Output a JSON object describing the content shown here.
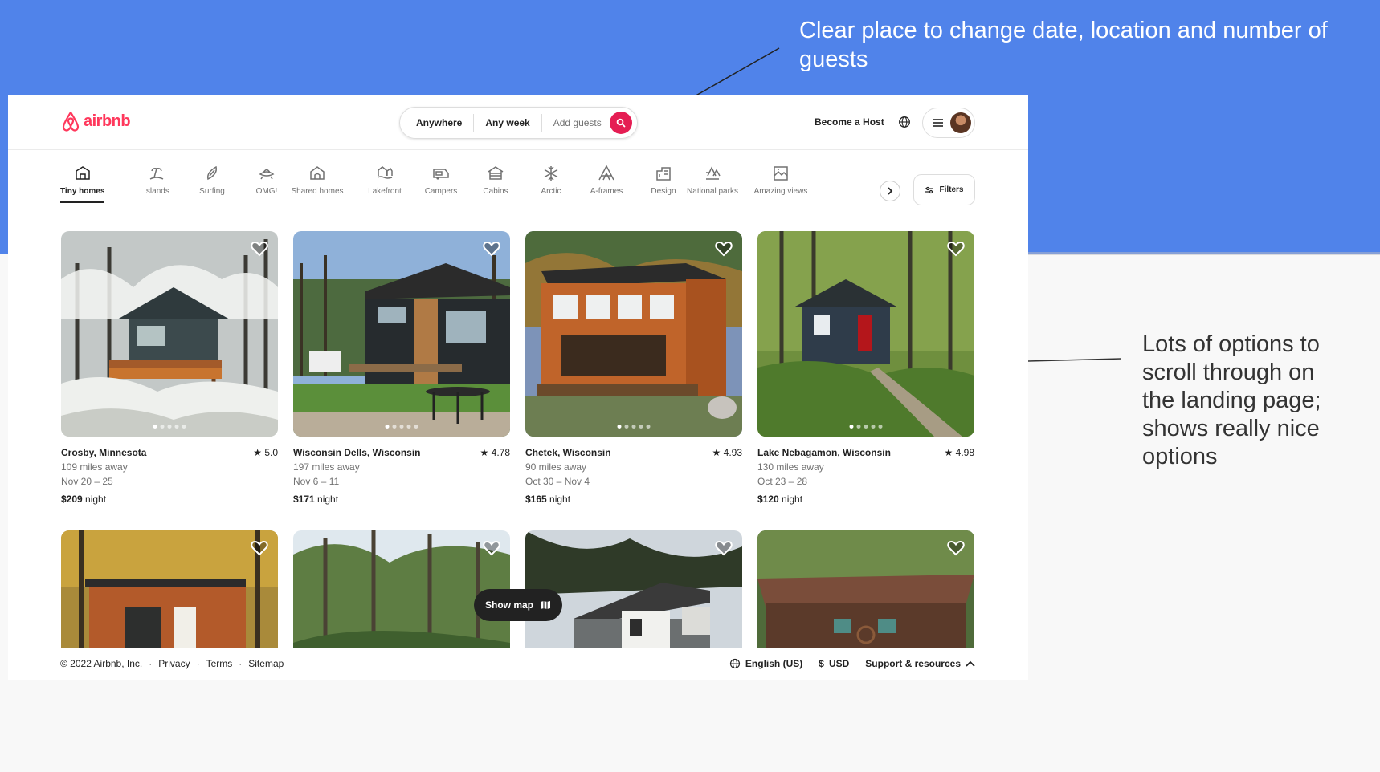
{
  "annotations": {
    "top": "Clear place to change date, location and number of guests",
    "right": "Lots of options to scroll through on the landing page; shows really nice options"
  },
  "colors": {
    "brand": "#ff385c",
    "search_button": "#e51d53",
    "slide_background": "#5083ea"
  },
  "header": {
    "logo": "airbnb",
    "search": {
      "where": "Anywhere",
      "when": "Any week",
      "guests": "Add guests"
    },
    "become_host": "Become a Host"
  },
  "categories": [
    {
      "label": "Tiny homes",
      "icon": "tiny-home-icon",
      "active": true
    },
    {
      "label": "Islands",
      "icon": "island-icon"
    },
    {
      "label": "Surfing",
      "icon": "surfboard-icon"
    },
    {
      "label": "OMG!",
      "icon": "ufo-icon"
    },
    {
      "label": "Shared homes",
      "icon": "shared-home-icon"
    },
    {
      "label": "Lakefront",
      "icon": "lakefront-icon"
    },
    {
      "label": "Campers",
      "icon": "camper-icon"
    },
    {
      "label": "Cabins",
      "icon": "cabin-icon"
    },
    {
      "label": "Arctic",
      "icon": "snowflake-icon"
    },
    {
      "label": "A-frames",
      "icon": "a-frame-icon"
    },
    {
      "label": "Design",
      "icon": "design-icon"
    },
    {
      "label": "National parks",
      "icon": "national-park-icon"
    },
    {
      "label": "Amazing views",
      "icon": "view-icon"
    }
  ],
  "filters_label": "Filters",
  "listings": [
    {
      "title": "Crosby, Minnesota",
      "rating": "5.0",
      "distance": "109 miles away",
      "dates": "Nov 20 – 25",
      "price": "$209",
      "unit": "night"
    },
    {
      "title": "Wisconsin Dells, Wisconsin",
      "rating": "4.78",
      "distance": "197 miles away",
      "dates": "Nov 6 – 11",
      "price": "$171",
      "unit": "night"
    },
    {
      "title": "Chetek, Wisconsin",
      "rating": "4.93",
      "distance": "90 miles away",
      "dates": "Oct 30 – Nov 4",
      "price": "$165",
      "unit": "night"
    },
    {
      "title": "Lake Nebagamon, Wisconsin",
      "rating": "4.98",
      "distance": "130 miles away",
      "dates": "Oct 23 – 28",
      "price": "$120",
      "unit": "night"
    }
  ],
  "show_map": "Show map",
  "footer": {
    "copyright": "© 2022 Airbnb, Inc.",
    "sep": "·",
    "links": [
      "Privacy",
      "Terms",
      "Sitemap"
    ],
    "language": "English (US)",
    "currency_symbol": "$",
    "currency": "USD",
    "support": "Support & resources"
  }
}
